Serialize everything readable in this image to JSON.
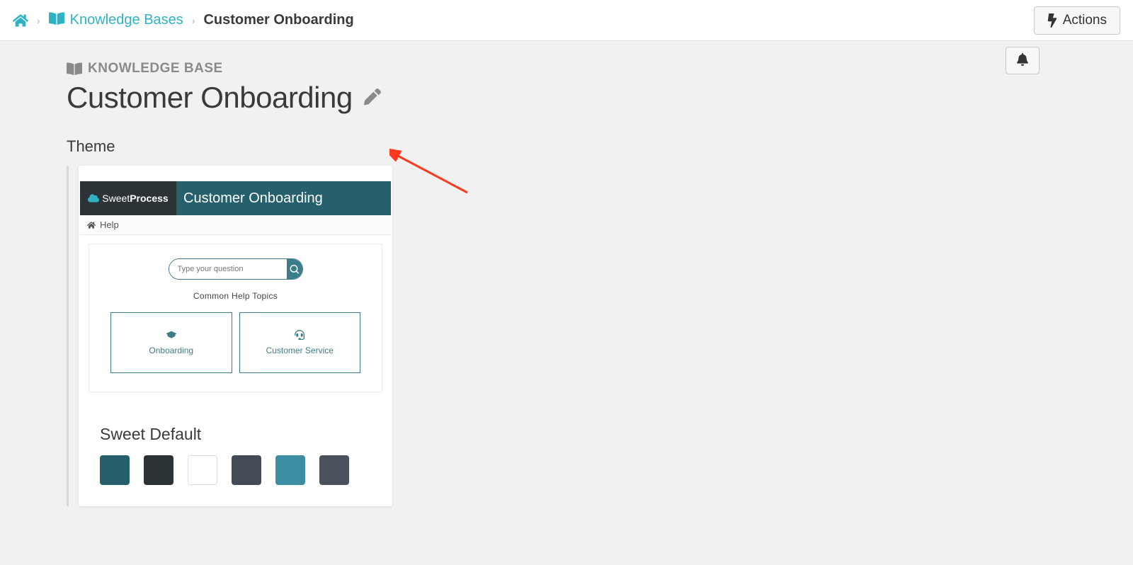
{
  "breadcrumbs": {
    "home_aria": "Home",
    "knowledge_bases": "Knowledge Bases",
    "current": "Customer Onboarding"
  },
  "header": {
    "actions_label": "Actions",
    "bell_aria": "Notifications"
  },
  "page": {
    "kicker": "KNOWLEDGE BASE",
    "title": "Customer Onboarding",
    "edit_aria": "Edit title"
  },
  "theme": {
    "section_label": "Theme",
    "preview": {
      "brand_sweet": "Sweet",
      "brand_process": "Process",
      "title": "Customer Onboarding",
      "help_label": "Help",
      "search_placeholder": "Type your question",
      "common_topics_label": "Common Help Topics",
      "topics": [
        {
          "label": "Onboarding",
          "icon": "graduation-cap-icon"
        },
        {
          "label": "Customer Service",
          "icon": "headset-icon"
        }
      ]
    },
    "name": "Sweet Default",
    "swatches": [
      "#26606c",
      "#2c3337",
      "#ffffff",
      "#454b55",
      "#3c8fa3",
      "#4b525d"
    ]
  }
}
